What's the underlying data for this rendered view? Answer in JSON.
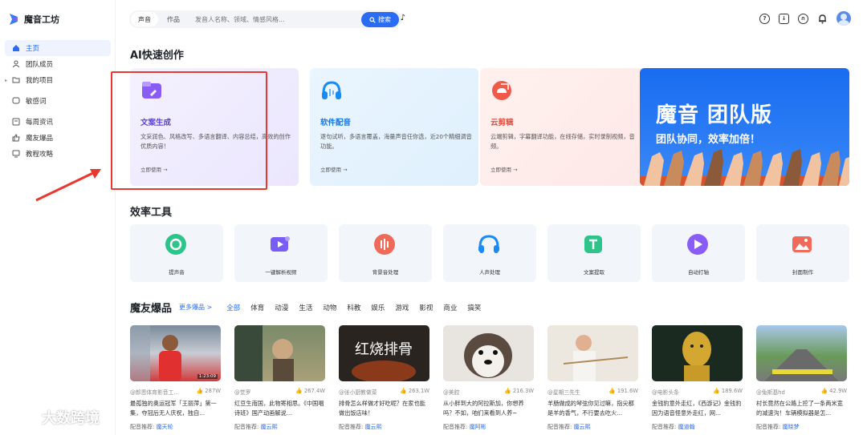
{
  "app": {
    "name": "魔音工坊"
  },
  "sidebar": {
    "items": [
      {
        "label": "主页",
        "icon": "home-icon"
      },
      {
        "label": "团队成员",
        "icon": "user-icon"
      },
      {
        "label": "我的项目",
        "icon": "folder-icon"
      },
      {
        "label": "敏感词",
        "icon": "chat-icon"
      },
      {
        "label": "每周资讯",
        "icon": "news-icon"
      },
      {
        "label": "魔友爆品",
        "icon": "thumb-icon"
      },
      {
        "label": "教程攻略",
        "icon": "monitor-icon"
      }
    ]
  },
  "search": {
    "tabs": [
      "声音",
      "作品"
    ],
    "placeholder": "发音人名称、领域、情感风格...",
    "button": "搜索"
  },
  "ai_section": {
    "title": "AI快速创作",
    "cards": [
      {
        "title": "文案生成",
        "desc": "文采润色、风格改写、多语言翻译、内容总结，高效的创作优质内容！",
        "link": "立即使用 →"
      },
      {
        "title": "软件配音",
        "desc": "逐句试听，多语言覆盖，海量声音任你选，近20个精细调音功能。",
        "link": "立即使用 →"
      },
      {
        "title": "云剪辑",
        "desc": "云端剪辑，字幕翻译功能，在线存储，实时录制视频，音频。",
        "link": "立即使用 →"
      }
    ],
    "banner": {
      "title": "魔音 团队版",
      "subtitle": "团队协同，效率加倍！"
    }
  },
  "tools_section": {
    "title": "效率工具",
    "tools": [
      "提声音",
      "一键解析视频",
      "背景音处理",
      "人声处理",
      "文案提取",
      "自动打轴",
      "封面制作"
    ]
  },
  "products_section": {
    "title": "魔友爆品",
    "more": "更多爆品 >",
    "categories": [
      "全部",
      "体育",
      "动漫",
      "生活",
      "动物",
      "科教",
      "娱乐",
      "游戏",
      "影视",
      "商业",
      "搞笑"
    ],
    "items": [
      {
        "author": "@郎恩体育影音工...",
        "likes": "287W",
        "desc": "最孤独的奥运冠军「王丽萍」第一集，夺冠后无人庆祝，独自...",
        "rec_label": "配音推荐:",
        "voice": "魔天轮",
        "duration": "1:23:09"
      },
      {
        "author": "@觉罗",
        "likes": "267.4W",
        "desc": "红豆生南国，此物寄相思。《中国唱诗班》国产动画解说...",
        "rec_label": "配音推荐:",
        "voice": "魔云熙",
        "duration": ""
      },
      {
        "author": "@张小厨教做菜",
        "likes": "263.1W",
        "desc": "排骨怎么样做才好吃呢？在家也能做出饭店味！",
        "rec_label": "配音推荐:",
        "voice": "魔云熙",
        "duration": ""
      },
      {
        "author": "@美腔",
        "likes": "216.3W",
        "desc": "从小胖到大的阿拉斯加，你想养吗？不如，咱们来看到人养~",
        "rec_label": "配音推荐:",
        "voice": "魔阿彬",
        "duration": ""
      },
      {
        "author": "@星期三先生",
        "likes": "191.6W",
        "desc": "羊肠做成的琴弦你见过嘛，指尖都是羊的香气，不行要去吃火...",
        "rec_label": "配音推荐:",
        "voice": "魔云熙",
        "duration": ""
      },
      {
        "author": "@电影头条",
        "likes": "189.6W",
        "desc": "金钱豹意外走红，《西游记》金钱豹因为语音怪意外走红，网...",
        "rec_label": "配音推荐:",
        "voice": "魔道翰",
        "duration": ""
      },
      {
        "author": "@兔斯基hd",
        "likes": "42.9W",
        "desc": "村长竟然在公路上挖了一条两米宽的减速沟！车辆模拟器是怎...",
        "rec_label": "配音推荐:",
        "voice": "魔晓梦",
        "duration": ""
      }
    ]
  },
  "watermark": {
    "text": "大数跨境"
  },
  "colors": {
    "accent": "#2a6df4",
    "highlight_box": "#e8382f"
  }
}
